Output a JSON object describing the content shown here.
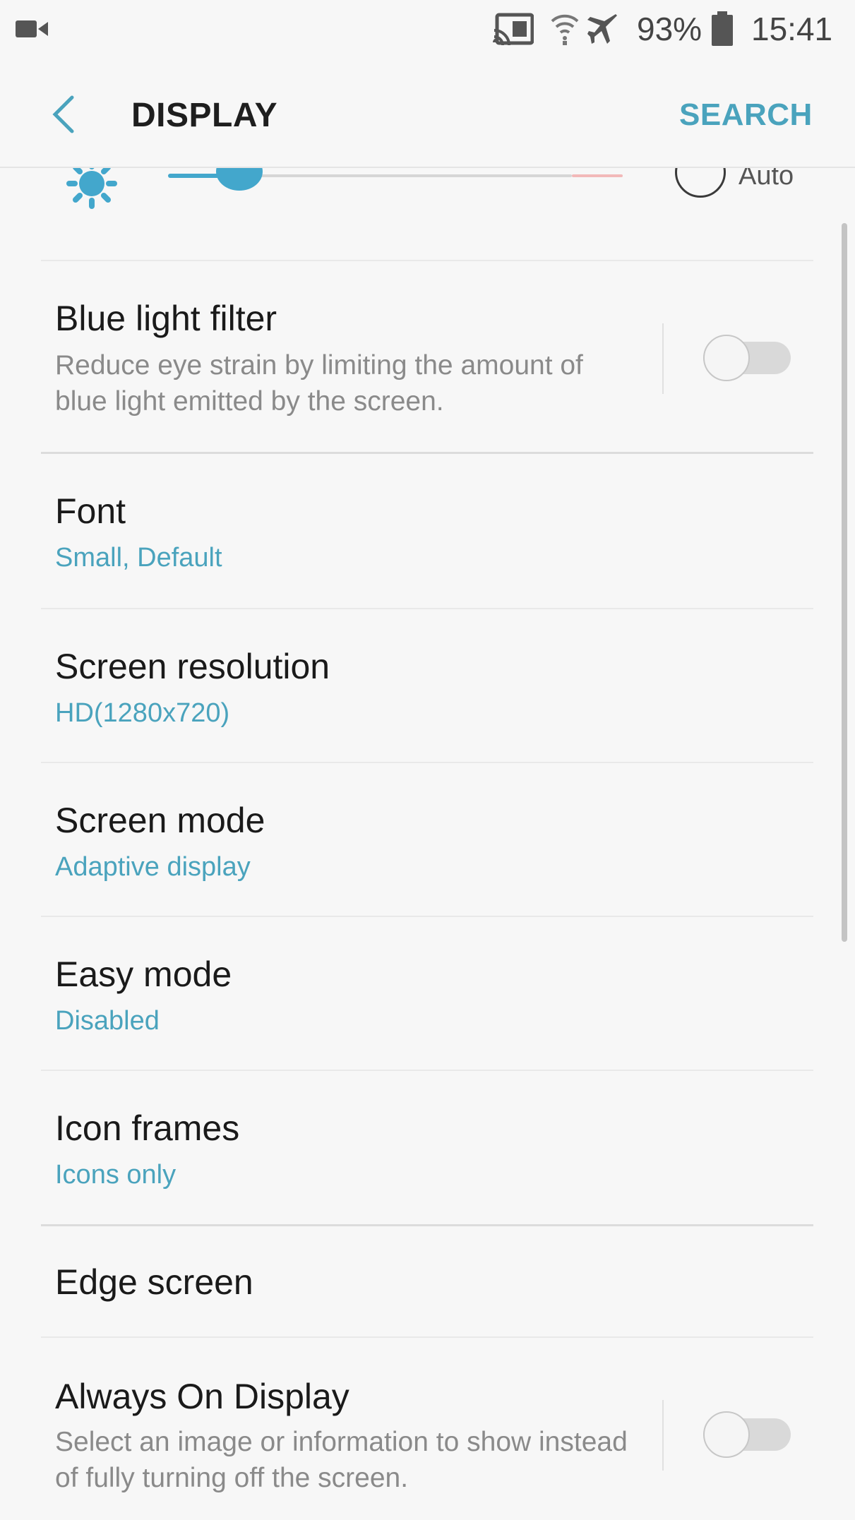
{
  "status_bar": {
    "battery_percent": "93%",
    "time": "15:41",
    "icons": [
      "video-icon",
      "cast-icon",
      "wifi-icon",
      "airplane-icon",
      "battery-icon"
    ]
  },
  "app_bar": {
    "title": "DISPLAY",
    "search_label": "SEARCH",
    "accent_color": "#4aa3bd"
  },
  "brightness": {
    "level": 0.16,
    "auto_label": "Auto",
    "auto_enabled": false
  },
  "settings": [
    {
      "title": "Blue light filter",
      "description": "Reduce eye strain by limiting the amount of blue light emitted by the screen.",
      "toggle": false
    },
    {
      "title": "Font",
      "value": "Small, Default"
    },
    {
      "title": "Screen resolution",
      "value": "HD(1280x720)"
    },
    {
      "title": "Screen mode",
      "value": "Adaptive display"
    },
    {
      "title": "Easy mode",
      "value": "Disabled"
    },
    {
      "title": "Icon frames",
      "value": "Icons only"
    },
    {
      "title": "Edge screen"
    },
    {
      "title": "Always On Display",
      "description": "Select an image or information to show instead of fully turning off the screen.",
      "toggle": false
    }
  ]
}
